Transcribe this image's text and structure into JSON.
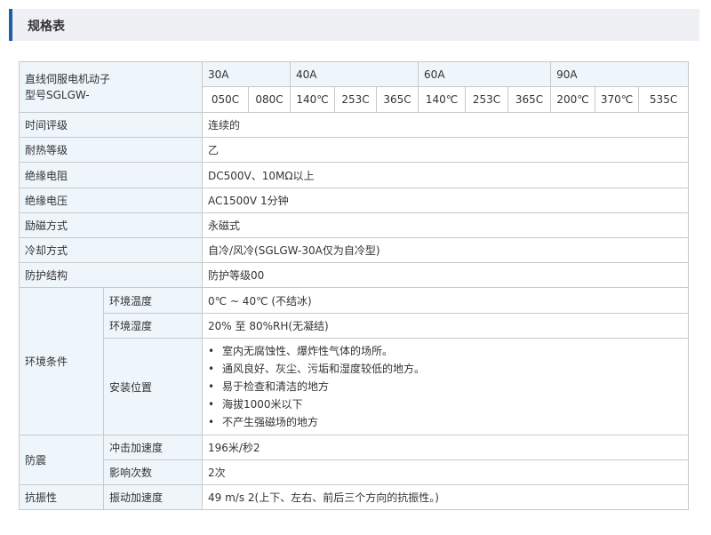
{
  "section": {
    "title": "规格表"
  },
  "table": {
    "header_label": "直线伺服电机动子\n型号SGLGW-",
    "groups": [
      {
        "name": "30A",
        "models": [
          "050C",
          "080C"
        ]
      },
      {
        "name": "40A",
        "models": [
          "140℃",
          "253C",
          "365C"
        ]
      },
      {
        "name": "60A",
        "models": [
          "140℃",
          "253C",
          "365C"
        ]
      },
      {
        "name": "90A",
        "models": [
          "200℃",
          "370℃",
          "535C"
        ]
      }
    ],
    "rows": {
      "time_rating": {
        "label": "时间评级",
        "value": "连续的"
      },
      "heat_class": {
        "label": "耐热等级",
        "value": "乙"
      },
      "insulation_resistance": {
        "label": "绝缘电阻",
        "value": "DC500V、10MΩ以上"
      },
      "insulation_voltage": {
        "label": "绝缘电压",
        "value": "AC1500V 1分钟"
      },
      "excitation": {
        "label": "励磁方式",
        "value": "永磁式"
      },
      "cooling": {
        "label": "冷却方式",
        "value": "自冷/风冷(SGLGW-30A仅为自冷型)"
      },
      "protection": {
        "label": "防护结构",
        "value": "防护等级00"
      }
    },
    "environment": {
      "label": "环境条件",
      "temperature": {
        "label": "环境温度",
        "value": "0℃ ~ 40℃ (不结冰)"
      },
      "humidity": {
        "label": "环境湿度",
        "value": "20% 至 80%RH(无凝结)"
      },
      "installation": {
        "label": "安装位置",
        "bullet": "•",
        "items": [
          "室内无腐蚀性、爆炸性气体的场所。",
          "通风良好、灰尘、污垢和湿度较低的地方。",
          "易于检查和清洁的地方",
          "海拔1000米以下",
          "不产生强磁场的地方"
        ]
      }
    },
    "shock": {
      "label": "防震",
      "acceleration": {
        "label": "冲击加速度",
        "value": "196米/秒2"
      },
      "count": {
        "label": "影响次数",
        "value": "2次"
      }
    },
    "vibration": {
      "label": "抗振性",
      "acceleration": {
        "label": "振动加速度",
        "value": "49 m/s 2(上下、左右、前后三个方向的抗振性。)"
      }
    }
  }
}
